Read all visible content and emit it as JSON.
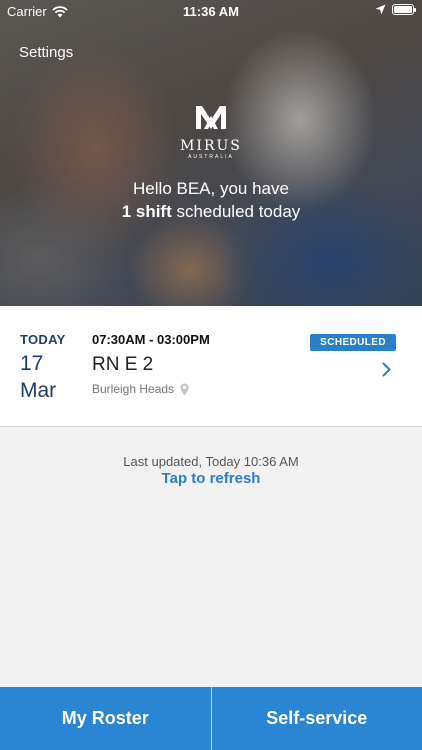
{
  "status_bar": {
    "carrier": "Carrier",
    "time": "11:36 AM"
  },
  "header": {
    "settings_label": "Settings"
  },
  "logo": {
    "mark": "M",
    "name": "MIRUS",
    "sub": "AUSTRALIA"
  },
  "greeting": {
    "line1": "Hello BEA, you have",
    "count": "1 shift",
    "rest": " scheduled today"
  },
  "shift": {
    "day_label": "TODAY",
    "day": "17",
    "month": "Mar",
    "time_range": "07:30AM - 03:00PM",
    "role": "RN E 2",
    "location": "Burleigh Heads",
    "status": "SCHEDULED"
  },
  "update": {
    "last_updated": "Last updated, Today 10:36 AM",
    "refresh_label": "Tap to refresh"
  },
  "tabs": [
    {
      "label": "My Roster"
    },
    {
      "label": "Self-service"
    }
  ],
  "colors": {
    "accent": "#2a86d3",
    "date_text": "#1e3f6b",
    "badge": "#2a7fc9"
  },
  "icons": {
    "wifi": "wifi-icon",
    "location": "location-arrow-icon",
    "battery": "battery-icon",
    "pin": "map-pin-icon",
    "chevron": "chevron-right-icon"
  }
}
